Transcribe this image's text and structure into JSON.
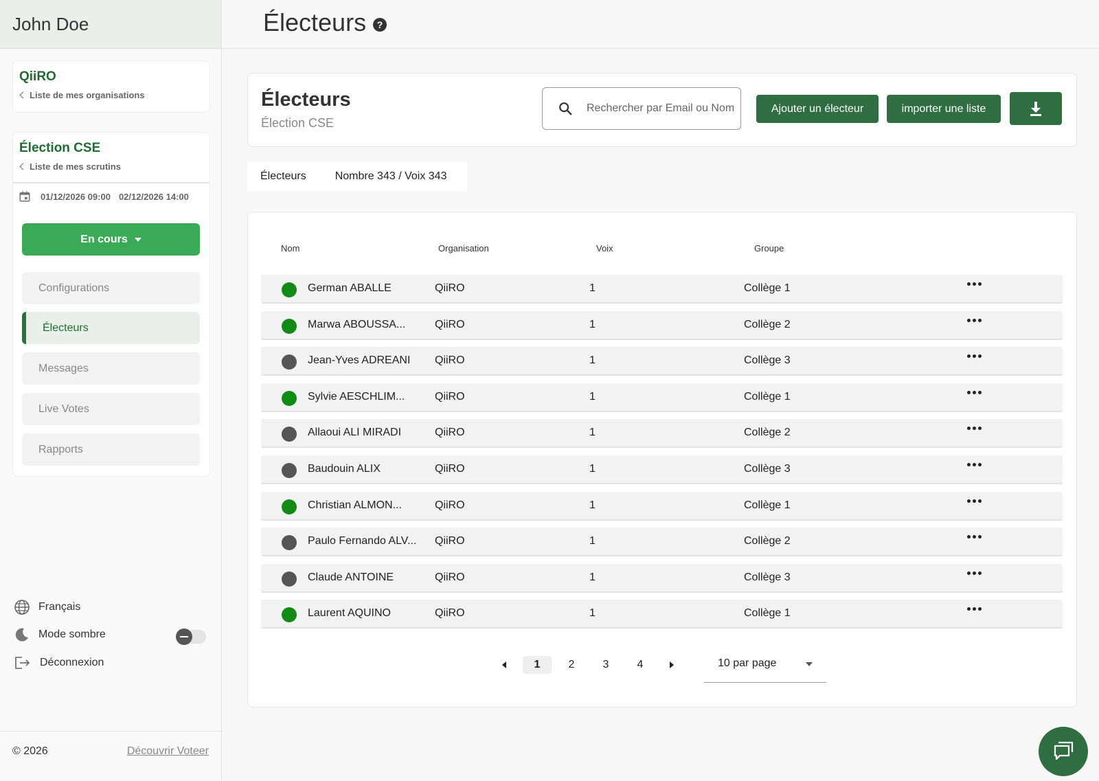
{
  "user": {
    "name": "John Doe"
  },
  "organisation": {
    "name": "QiiRO",
    "back_label": "Liste de mes organisations"
  },
  "election": {
    "name": "Élection CSE",
    "back_label": "Liste de mes scrutins",
    "start": "01/12/2026 09:00",
    "end": "02/12/2026 14:00",
    "status": "En cours"
  },
  "nav": {
    "items": [
      {
        "label": "Configurations",
        "active": false
      },
      {
        "label": "Électeurs",
        "active": true
      },
      {
        "label": "Messages",
        "active": false
      },
      {
        "label": "Live Votes",
        "active": false
      },
      {
        "label": "Rapports",
        "active": false
      }
    ]
  },
  "settings": {
    "language": "Français",
    "dark_mode": "Mode sombre",
    "dark_mode_on": false,
    "logout": "Déconnexion"
  },
  "footer": {
    "copyright": "© 2026",
    "discover": "Découvrir Voteer"
  },
  "page": {
    "title": "Électeurs"
  },
  "header_card": {
    "title": "Électeurs",
    "subtitle": "Élection CSE",
    "search_placeholder": "Rechercher par Email ou Nom",
    "add_button": "Ajouter un électeur",
    "import_button": "importer une liste"
  },
  "tabs": {
    "label": "Électeurs",
    "count": "Nombre 343  / Voix 343"
  },
  "table": {
    "headers": {
      "name": "Nom",
      "organisation": "Organisation",
      "votes": "Voix",
      "group": "Groupe"
    },
    "rows": [
      {
        "status": "green",
        "name": "German ABALLE",
        "organisation": "QiiRO",
        "votes": "1",
        "group": "Collège 1"
      },
      {
        "status": "green",
        "name": "Marwa ABOUSSA...",
        "organisation": "QiiRO",
        "votes": "1",
        "group": "Collège 2"
      },
      {
        "status": "gray",
        "name": "Jean-Yves ADREANI",
        "organisation": "QiiRO",
        "votes": "1",
        "group": "Collège 3"
      },
      {
        "status": "green",
        "name": "Sylvie AESCHLIM...",
        "organisation": "QiiRO",
        "votes": "1",
        "group": "Collège 1"
      },
      {
        "status": "gray",
        "name": "Allaoui ALI MIRADI",
        "organisation": "QiiRO",
        "votes": "1",
        "group": "Collège 2"
      },
      {
        "status": "gray",
        "name": "Baudouin ALIX",
        "organisation": "QiiRO",
        "votes": "1",
        "group": "Collège 3"
      },
      {
        "status": "green",
        "name": "Christian ALMON...",
        "organisation": "QiiRO",
        "votes": "1",
        "group": "Collège 1"
      },
      {
        "status": "gray",
        "name": "Paulo Fernando ALV...",
        "organisation": "QiiRO",
        "votes": "1",
        "group": "Collège 2"
      },
      {
        "status": "gray",
        "name": "Claude ANTOINE",
        "organisation": "QiiRO",
        "votes": "1",
        "group": "Collège 3"
      },
      {
        "status": "green",
        "name": "Laurent AQUINO",
        "organisation": "QiiRO",
        "votes": "1",
        "group": "Collège 1"
      }
    ]
  },
  "pagination": {
    "pages": [
      "1",
      "2",
      "3",
      "4"
    ],
    "current": "1",
    "per_page": "10 par page"
  },
  "colors": {
    "primary": "#2f6e40",
    "status_green": "#3aaa56",
    "online": "#128a16",
    "offline": "#555555"
  }
}
